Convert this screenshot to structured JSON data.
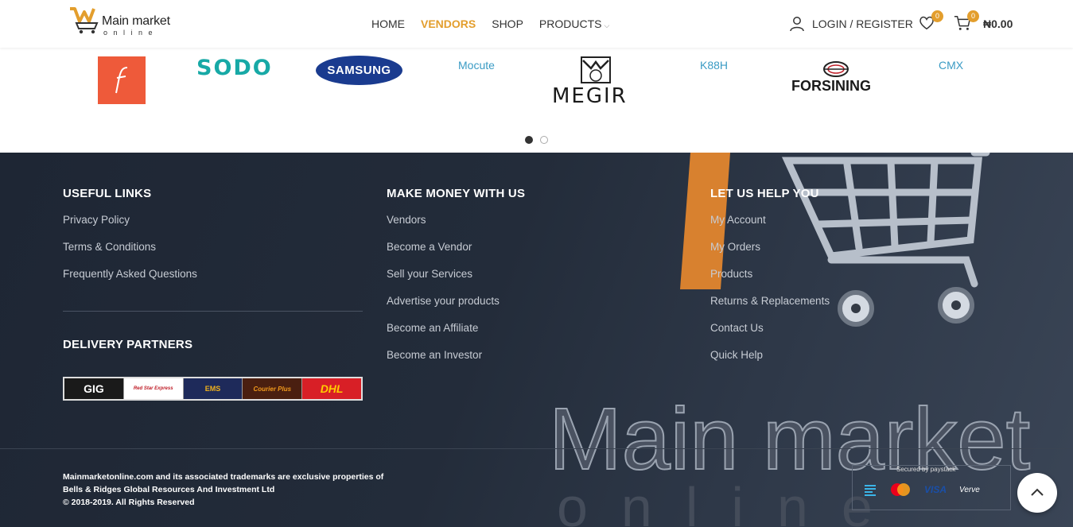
{
  "header": {
    "logo_name": "Main market",
    "logo_sub": "online",
    "nav": [
      {
        "label": "HOME"
      },
      {
        "label": "VENDORS"
      },
      {
        "label": "SHOP"
      },
      {
        "label": "PRODUCTS"
      }
    ],
    "account_label": "LOGIN / REGISTER",
    "wishlist_count": "0",
    "cart_count": "0",
    "cart_total": "₦0.00",
    "accent_color": "#e39e2d"
  },
  "brands": {
    "items": [
      {
        "name": "F",
        "icon": "f-brand-logo"
      },
      {
        "name": "SODO"
      },
      {
        "name": "SAMSUNG"
      },
      {
        "name": "Mocute"
      },
      {
        "name": "MEGIR"
      },
      {
        "name": "K88H"
      },
      {
        "name": "FORSINING"
      },
      {
        "name": "CMX"
      }
    ]
  },
  "footer": {
    "useful_links": {
      "title": "USEFUL LINKS",
      "links": [
        "Privacy Policy",
        "Terms & Conditions",
        "Frequently Asked Questions"
      ]
    },
    "make_money": {
      "title": "MAKE MONEY WITH US",
      "links": [
        "Vendors",
        "Become a Vendor",
        "Sell your Services",
        "Advertise your products",
        "Become an Affiliate",
        "Become an Investor"
      ]
    },
    "help": {
      "title": "LET US HELP YOU",
      "links": [
        "My Account",
        "My Orders",
        "Products",
        "Returns & Replacements",
        "Contact Us",
        "Quick Help"
      ]
    },
    "delivery": {
      "title": "DELIVERY PARTNERS",
      "partners": [
        "GIG",
        "Red Star Express",
        "EMS",
        "Courier Plus",
        "DHL"
      ]
    },
    "copyright": {
      "line1": "Mainmarketonline.com and its associated trademarks are exclusive properties of",
      "line2": "Bells & Ridges Global Resources And Investment Ltd",
      "line3": "© 2018-2019. All Rights Reserved"
    },
    "bg_text": "Main market",
    "payment": {
      "secured": "Secured by paystack",
      "cards": [
        "VISA",
        "Verve"
      ]
    }
  }
}
